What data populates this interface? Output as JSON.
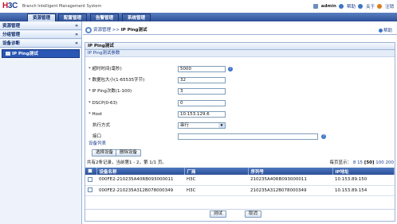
{
  "header": {
    "logo_h": "H",
    "logo_3c": "3C",
    "system_name": "Branch Intelligent Management System",
    "user": "admin",
    "help": "帮助",
    "about": "关于",
    "logout": "注销"
  },
  "tabs": [
    "资源管理",
    "配置管理",
    "告警管理",
    "系统管理"
  ],
  "sidebar": {
    "sections": [
      {
        "label": "资源管理",
        "chevron": "»"
      },
      {
        "label": "分组管理",
        "chevron": "»"
      },
      {
        "label": "设备诊断",
        "chevron": "«"
      }
    ],
    "active_item": "IP Ping测试"
  },
  "breadcrumb": {
    "prefix": "资源管理",
    "sep": ">>",
    "current": "IP Ping测试"
  },
  "help_link": "帮助",
  "panel": {
    "title": "IP Ping测试",
    "params_title": "IP Ping测试参数",
    "fields": [
      {
        "label": "* 超时时间(毫秒)",
        "value": "5000",
        "help": true
      },
      {
        "label": "* 数据包大小(1-65535字节)",
        "value": "32"
      },
      {
        "label": "* IP Ping次数(1-100)",
        "value": "3"
      },
      {
        "label": "* DSCP(0-63)",
        "value": "0"
      },
      {
        "label": "* Host",
        "value": "10.153.129.6"
      }
    ],
    "exec_label": "执行方式",
    "exec_value": "串行",
    "iface_label": "接口",
    "iface_value": "",
    "device_list_title": "设备列表",
    "select_button": "选择设备",
    "remove_button": "删除设备",
    "summary": "共有2条记录，当前第1 - 2，第 1/1 页。",
    "pager_label": "每页显示：",
    "pager_options": [
      "8",
      "15",
      "[50]",
      "100",
      "200"
    ],
    "columns": [
      "设备名称",
      "厂商",
      "序列号",
      "IP地址"
    ],
    "rows": [
      {
        "name": "000FE2-210235A40RB093000011",
        "vendor": "H3C",
        "serial": "210235A40RB093000011",
        "ip": "10.153.89.150"
      },
      {
        "name": "000FE2-210235A312B078000349",
        "vendor": "H3C",
        "serial": "210235A312B078000349",
        "ip": "10.153.89.154"
      }
    ],
    "test_button": "测试",
    "cancel_button": "取消"
  },
  "colors": {
    "accent": "#2a56b5",
    "header_blue": "#2c4f96",
    "logo_red": "#c8102e"
  }
}
